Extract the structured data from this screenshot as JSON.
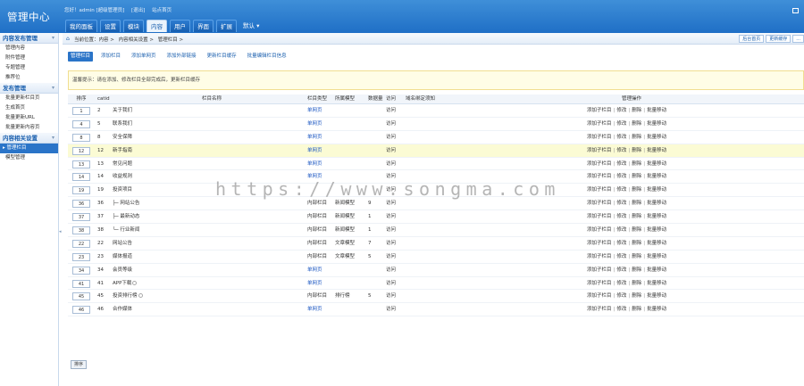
{
  "header": {
    "logo": "管理中心",
    "welcome": [
      "您好！admin [超级管理员]",
      "[退出]",
      "站点首页"
    ],
    "tabs": [
      {
        "label": "我的面板",
        "active": false
      },
      {
        "label": "设置",
        "active": false
      },
      {
        "label": "模块",
        "active": false
      },
      {
        "label": "内容",
        "active": true
      },
      {
        "label": "用户",
        "active": false
      },
      {
        "label": "界面",
        "active": false
      },
      {
        "label": "扩展",
        "active": false
      },
      {
        "label": "默认 ▾",
        "active": false,
        "dropdown": true
      }
    ]
  },
  "sidebar": {
    "sections": [
      {
        "title": "内容发布管理",
        "items": [
          "管理内容",
          "附件管理",
          "专题管理",
          "推荐位"
        ]
      },
      {
        "title": "发布管理",
        "items": [
          "批量更新栏目页",
          "生成首页",
          "批量更新URL",
          "批量更新内容页"
        ]
      },
      {
        "title": "内容相关设置",
        "items": [
          "管理栏目",
          "模型管理"
        ],
        "active_index": 0
      }
    ]
  },
  "breadcrumb": {
    "items": [
      "当前位置：内容 >",
      "内容相关设置 >",
      "管理栏目 >"
    ],
    "buttons": [
      "后台首页",
      "更新缓存",
      "..."
    ]
  },
  "subtabs": [
    {
      "label": "管理栏目",
      "active": true
    },
    {
      "label": "添加栏目",
      "active": false
    },
    {
      "label": "添加单网页",
      "active": false
    },
    {
      "label": "添加外部链接",
      "active": false
    },
    {
      "label": "更新栏目缓存",
      "active": false
    },
    {
      "label": "批量编辑栏目信息",
      "active": false
    }
  ],
  "tip": "温馨提示：请在添加、修改栏目全部完成后，更新栏目缓存",
  "table": {
    "headers": {
      "sort": "排序",
      "catid": "catid",
      "name": "栏目名称",
      "type": "栏目类型",
      "model": "所属模型",
      "data": "数据量",
      "visit": "访问",
      "domain": "域名绑定须知",
      "ops": "管理操作"
    },
    "rows": [
      {
        "sort": "1",
        "catid": "2",
        "name": "关于我们",
        "type": "单网页",
        "model": "",
        "data": "",
        "visit": "访问",
        "ops": [
          "添加子栏目",
          "修改",
          "删除",
          "批量移动"
        ]
      },
      {
        "sort": "4",
        "catid": "5",
        "name": "联系我们",
        "type": "单网页",
        "model": "",
        "data": "",
        "visit": "访问",
        "ops": [
          "添加子栏目",
          "修改",
          "删除",
          "批量移动"
        ]
      },
      {
        "sort": "8",
        "catid": "8",
        "name": "安全保障",
        "type": "单网页",
        "model": "",
        "data": "",
        "visit": "访问",
        "ops": [
          "添加子栏目",
          "修改",
          "删除",
          "批量移动"
        ]
      },
      {
        "sort": "12",
        "catid": "12",
        "name": "新手指南",
        "type": "单网页",
        "model": "",
        "data": "",
        "visit": "访问",
        "ops": [
          "添加子栏目",
          "修改",
          "删除",
          "批量移动"
        ],
        "highlight": true
      },
      {
        "sort": "13",
        "catid": "13",
        "name": "常见问题",
        "type": "单网页",
        "model": "",
        "data": "",
        "visit": "访问",
        "ops": [
          "添加子栏目",
          "修改",
          "删除",
          "批量移动"
        ]
      },
      {
        "sort": "14",
        "catid": "14",
        "name": "收益规则",
        "type": "单网页",
        "model": "",
        "data": "",
        "visit": "访问",
        "ops": [
          "添加子栏目",
          "修改",
          "删除",
          "批量移动"
        ]
      },
      {
        "sort": "19",
        "catid": "19",
        "name": "投资项目",
        "type": "",
        "model": "",
        "data": "",
        "visit": "访问",
        "ops": [
          "添加子栏目",
          "修改",
          "删除",
          "批量移动"
        ]
      },
      {
        "sort": "36",
        "catid": "36",
        "name": "├─ 网站公告",
        "type": "内部栏目",
        "model": "新闻模型",
        "data": "9",
        "visit": "访问",
        "ops": [
          "添加子栏目",
          "修改",
          "删除",
          "批量移动"
        ]
      },
      {
        "sort": "37",
        "catid": "37",
        "name": "├─ 最新动态",
        "type": "内部栏目",
        "model": "新闻模型",
        "data": "1",
        "visit": "访问",
        "ops": [
          "添加子栏目",
          "修改",
          "删除",
          "批量移动"
        ]
      },
      {
        "sort": "38",
        "catid": "38",
        "name": "└─ 行业新闻",
        "type": "内部栏目",
        "model": "新闻模型",
        "data": "1",
        "visit": "访问",
        "ops": [
          "添加子栏目",
          "修改",
          "删除",
          "批量移动"
        ]
      },
      {
        "sort": "22",
        "catid": "22",
        "name": "网站公告",
        "type": "内部栏目",
        "model": "文章模型",
        "data": "7",
        "visit": "访问",
        "ops": [
          "添加子栏目",
          "修改",
          "删除",
          "批量移动"
        ]
      },
      {
        "sort": "23",
        "catid": "23",
        "name": "媒体报道",
        "type": "内部栏目",
        "model": "文章模型",
        "data": "5",
        "visit": "访问",
        "ops": [
          "添加子栏目",
          "修改",
          "删除",
          "批量移动"
        ]
      },
      {
        "sort": "34",
        "catid": "34",
        "name": "会员等级",
        "type": "单网页",
        "model": "",
        "data": "",
        "visit": "访问",
        "ops": [
          "添加子栏目",
          "修改",
          "删除",
          "批量移动"
        ]
      },
      {
        "sort": "41",
        "catid": "41",
        "name": "APP下载",
        "type": "单网页",
        "model": "",
        "data": "",
        "visit": "访问",
        "ops": [
          "添加子栏目",
          "修改",
          "删除",
          "批量移动"
        ],
        "info_icon": true
      },
      {
        "sort": "45",
        "catid": "45",
        "name": "投资排行榜",
        "type": "内部栏目",
        "model": "排行榜",
        "data": "5",
        "visit": "访问",
        "ops": [
          "添加子栏目",
          "修改",
          "删除",
          "批量移动"
        ],
        "info_icon": true
      },
      {
        "sort": "46",
        "catid": "46",
        "name": "合作媒体",
        "type": "单网页",
        "model": "",
        "data": "",
        "visit": "访问",
        "ops": [
          "添加子栏目",
          "修改",
          "删除",
          "批量移动"
        ]
      }
    ]
  },
  "sort_button": "排序",
  "watermark": "https://www.songma.com"
}
